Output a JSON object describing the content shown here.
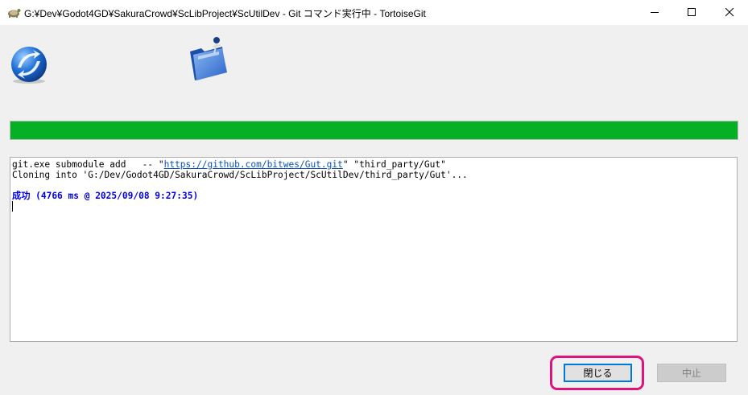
{
  "window": {
    "title": "G:¥Dev¥Godot4GD¥SakuraCrowd¥ScLibProject¥ScUtilDev - Git コマンド実行中 - TortoiseGit",
    "app_icon": "tortoise-icon",
    "controls": {
      "minimize": "minimize-icon",
      "maximize": "maximize-icon",
      "close": "close-icon"
    }
  },
  "icons": {
    "sync": "globe-sync-icon",
    "folder": "folder-icon"
  },
  "progress": {
    "value": 1.0,
    "color": "#06b025"
  },
  "log": {
    "line1": {
      "prefix": "git.exe submodule add   -- \"",
      "link": "https://github.com/bitwes/Gut.git",
      "suffix": "\" \"third_party/Gut\""
    },
    "line2": "Cloning into 'G:/Dev/Godot4GD/SakuraCrowd/ScLibProject/ScUtilDev/third_party/Gut'...",
    "line3": "",
    "success": "成功 (4766 ms @ 2025/09/08 9:27:35)"
  },
  "buttons": {
    "close_label": "閉じる",
    "abort_label": "中止"
  },
  "colors": {
    "highlight": "#e0137a",
    "focus": "#0078d7",
    "link": "#0b53b3",
    "success": "#0000e6"
  }
}
